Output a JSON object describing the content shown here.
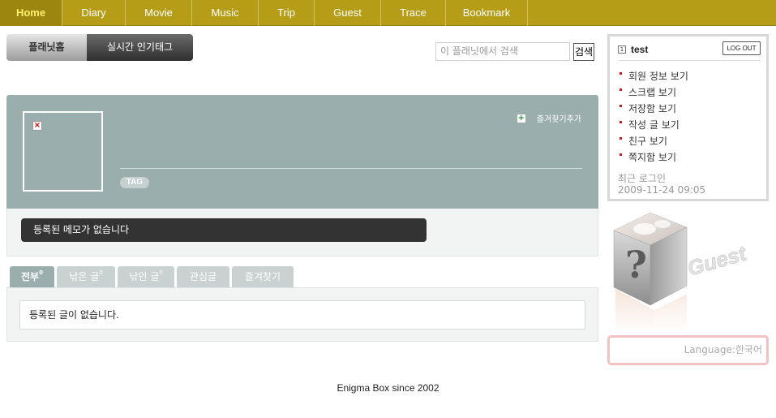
{
  "nav": {
    "items": [
      {
        "label": "Home",
        "active": true
      },
      {
        "label": "Diary",
        "active": false
      },
      {
        "label": "Movie",
        "active": false
      },
      {
        "label": "Music",
        "active": false
      },
      {
        "label": "Trip",
        "active": false
      },
      {
        "label": "Guest",
        "active": false
      },
      {
        "label": "Trace",
        "active": false
      },
      {
        "label": "Bookmark",
        "active": false
      }
    ]
  },
  "planet_tabs": {
    "home": "플래닛홈",
    "trending": "실시간 인기태그"
  },
  "search": {
    "placeholder": "이 플래닛에서 검색",
    "button": "검색"
  },
  "profile": {
    "favorite_add": "즐겨찾기추가",
    "tag": "TAG"
  },
  "memo": {
    "empty": "등록된 메모가 없습니다"
  },
  "post_tabs": [
    {
      "label": "전부",
      "count": "0",
      "active": true
    },
    {
      "label": "낚은 글",
      "count": "0",
      "active": false
    },
    {
      "label": "낚인 글",
      "count": "0",
      "active": false
    },
    {
      "label": "관심글",
      "count": "",
      "active": false
    },
    {
      "label": "즐겨찾기",
      "count": "",
      "active": false
    }
  ],
  "posts": {
    "empty": "등록된 글이 없습니다."
  },
  "footer": "Enigma Box since 2002",
  "user": {
    "level": "1",
    "name": "test",
    "logout": "LOG OUT",
    "menu": [
      "회원 정보 보기",
      "스크랩 보기",
      "저장함 보기",
      "작성 글 보기",
      "친구 보기",
      "쪽지함 보기"
    ],
    "last_login_label": "최근 로그인",
    "last_login_value": "2009-11-24 09:05"
  },
  "guest_art": {
    "text": "Guest",
    "glyph": "?"
  },
  "language": "Language:한국어",
  "colors": {
    "nav_bg": "#b59d18",
    "nav_active_text": "#ffef6a",
    "profile_bg": "#9baeae",
    "memo_bar": "#333333",
    "bullet": "#d01a1a"
  }
}
